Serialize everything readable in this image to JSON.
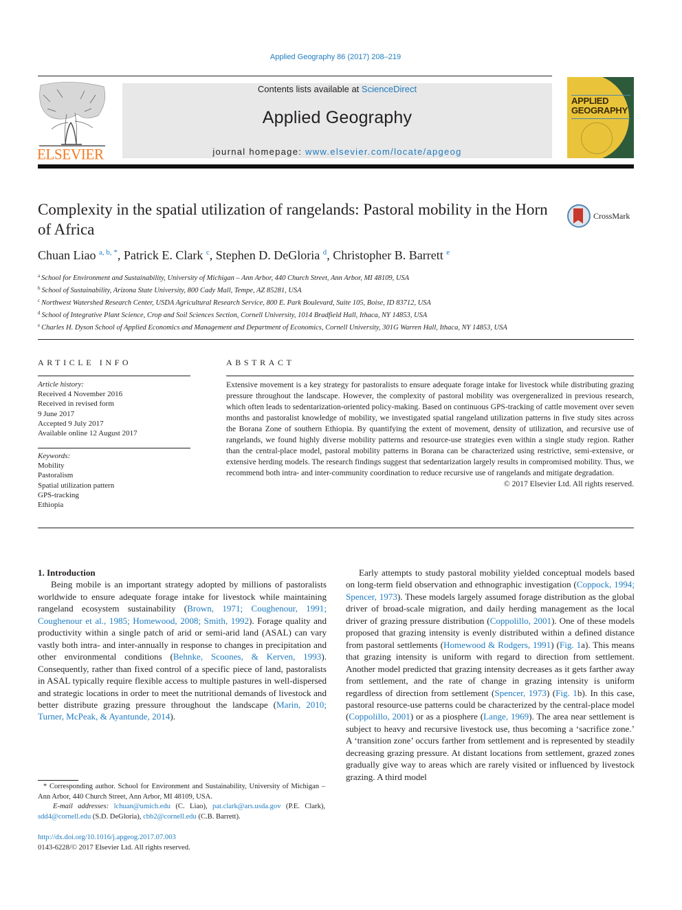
{
  "header": {
    "journal_ref": "Applied Geography 86 (2017) 208–219",
    "contents_prefix": "Contents lists available at ",
    "contents_link": "ScienceDirect",
    "journal_title": "Applied Geography",
    "homepage_prefix": "journal homepage: ",
    "homepage_link": "www.elsevier.com/locate/apgeog",
    "publisher_logo": "ELSEVIER",
    "cover_title_line1": "APPLIED",
    "cover_title_line2": "GEOGRAPHY",
    "crossmark_label": "CrossMark",
    "colors": {
      "link": "#1f7bbf",
      "elsevier_orange": "#f47920",
      "masthead_bg": "#e8e8e8"
    }
  },
  "article": {
    "title": "Complexity in the spatial utilization of rangelands: Pastoral mobility in the Horn of Africa",
    "authors": [
      {
        "name": "Chuan Liao",
        "sup": "a, b, *"
      },
      {
        "name": "Patrick E. Clark",
        "sup": "c"
      },
      {
        "name": "Stephen D. DeGloria",
        "sup": "d"
      },
      {
        "name": "Christopher B. Barrett",
        "sup": "e"
      }
    ],
    "affiliations": [
      {
        "sup": "a",
        "text": "School for Environment and Sustainability, University of Michigan – Ann Arbor, 440 Church Street, Ann Arbor, MI 48109, USA"
      },
      {
        "sup": "b",
        "text": "School of Sustainability, Arizona State University, 800 Cady Mall, Tempe, AZ 85281, USA"
      },
      {
        "sup": "c",
        "text": "Northwest Watershed Research Center, USDA Agricultural Research Service, 800 E. Park Boulevard, Suite 105, Boise, ID 83712, USA"
      },
      {
        "sup": "d",
        "text": "School of Integrative Plant Science, Crop and Soil Sciences Section, Cornell University, 1014 Bradfield Hall, Ithaca, NY 14853, USA"
      },
      {
        "sup": "e",
        "text": "Charles H. Dyson School of Applied Economics and Management and Department of Economics, Cornell University, 301G Warren Hall, Ithaca, NY 14853, USA"
      }
    ]
  },
  "article_info": {
    "heading": "ARTICLE INFO",
    "history_label": "Article history:",
    "history": [
      "Received 4 November 2016",
      "Received in revised form",
      "9 June 2017",
      "Accepted 9 July 2017",
      "Available online 12 August 2017"
    ],
    "keywords_label": "Keywords:",
    "keywords": [
      "Mobility",
      "Pastoralism",
      "Spatial utilization pattern",
      "GPS-tracking",
      "Ethiopia"
    ]
  },
  "abstract": {
    "heading": "ABSTRACT",
    "text": "Extensive movement is a key strategy for pastoralists to ensure adequate forage intake for livestock while distributing grazing pressure throughout the landscape. However, the complexity of pastoral mobility was overgeneralized in previous research, which often leads to sedentarization-oriented policy-making. Based on continuous GPS-tracking of cattle movement over seven months and pastoralist knowledge of mobility, we investigated spatial rangeland utilization patterns in five study sites across the Borana Zone of southern Ethiopia. By quantifying the extent of movement, density of utilization, and recursive use of rangelands, we found highly diverse mobility patterns and resource-use strategies even within a single study region. Rather than the central-place model, pastoral mobility patterns in Borana can be characterized using restrictive, semi-extensive, or extensive herding models. The research findings suggest that sedentarization largely results in compromised mobility. Thus, we recommend both intra- and inter-community coordination to reduce recursive use of rangelands and mitigate degradation.",
    "copyright": "© 2017 Elsevier Ltd. All rights reserved."
  },
  "body": {
    "section_heading": "1.  Introduction",
    "left_para": [
      {
        "t": "Being mobile is an important strategy adopted by millions of pastoralists worldwide to ensure adequate forage intake for livestock while maintaining rangeland ecosystem sustainability ("
      },
      {
        "l": "Brown, 1971; Coughenour, 1991; Coughenour et al., 1985; Homewood, 2008; Smith, 1992"
      },
      {
        "t": "). Forage quality and productivity within a single patch of arid or semi-arid land (ASAL) can vary vastly both intra- and inter-annually in response to changes in precipitation and other environmental conditions ("
      },
      {
        "l": "Behnke, Scoones, & Kerven, 1993"
      },
      {
        "t": "). Consequently, rather than fixed control of a specific piece of land, pastoralists in ASAL typically require flexible access to multiple pastures in well-dispersed and strategic locations in order to meet the nutritional demands of livestock and better distribute grazing pressure throughout the landscape ("
      },
      {
        "l": "Marin, 2010; Turner, McPeak, & Ayantunde, 2014"
      },
      {
        "t": ")."
      }
    ],
    "right_para": [
      {
        "t": "Early attempts to study pastoral mobility yielded conceptual models based on long-term field observation and ethnographic investigation ("
      },
      {
        "l": "Coppock, 1994; Spencer, 1973"
      },
      {
        "t": "). These models largely assumed forage distribution as the global driver of broad-scale migration, and daily herding management as the local driver of grazing pressure distribution ("
      },
      {
        "l": "Coppolillo, 2001"
      },
      {
        "t": "). One of these models proposed that grazing intensity is evenly distributed within a defined distance from pastoral settlements ("
      },
      {
        "l": "Homewood & Rodgers, 1991"
      },
      {
        "t": ") ("
      },
      {
        "l": "Fig. 1"
      },
      {
        "t": "a). This means that grazing intensity is uniform with regard to direction from settlement. Another model predicted that grazing intensity decreases as it gets farther away from settlement, and the rate of change in grazing intensity is uniform regardless of direction from settlement ("
      },
      {
        "l": "Spencer, 1973"
      },
      {
        "t": ") ("
      },
      {
        "l": "Fig. 1"
      },
      {
        "t": "b). In this case, pastoral resource-use patterns could be characterized by the central-place model ("
      },
      {
        "l": "Coppolillo, 2001"
      },
      {
        "t": ") or as a piosphere ("
      },
      {
        "l": "Lange, 1969"
      },
      {
        "t": "). The area near settlement is subject to heavy and recursive livestock use, thus becoming a ‘sacrifice zone.’ A ‘transition zone’ occurs farther from settlement and is represented by steadily decreasing grazing pressure. At distant locations from settlement, grazed zones gradually give way to areas which are rarely visited or influenced by livestock grazing. A third model"
      }
    ]
  },
  "footnotes": {
    "corresponding": "* Corresponding author. School for Environment and Sustainability, University of Michigan – Ann Arbor, 440 Church Street, Ann Arbor, MI 48109, USA.",
    "email_label": "E-mail addresses:",
    "emails": [
      {
        "addr": "lchuan@umich.edu",
        "who": "(C. Liao),"
      },
      {
        "addr": "pat.clark@ars.usda.gov",
        "who": "(P.E. Clark),"
      },
      {
        "addr": "sdd4@cornell.edu",
        "who": "(S.D. DeGloria),"
      },
      {
        "addr": "cbb2@cornell.edu",
        "who": "(C.B. Barrett)."
      }
    ],
    "doi": "http://dx.doi.org/10.1016/j.apgeog.2017.07.003",
    "issn": "0143-6228/© 2017 Elsevier Ltd. All rights reserved."
  }
}
